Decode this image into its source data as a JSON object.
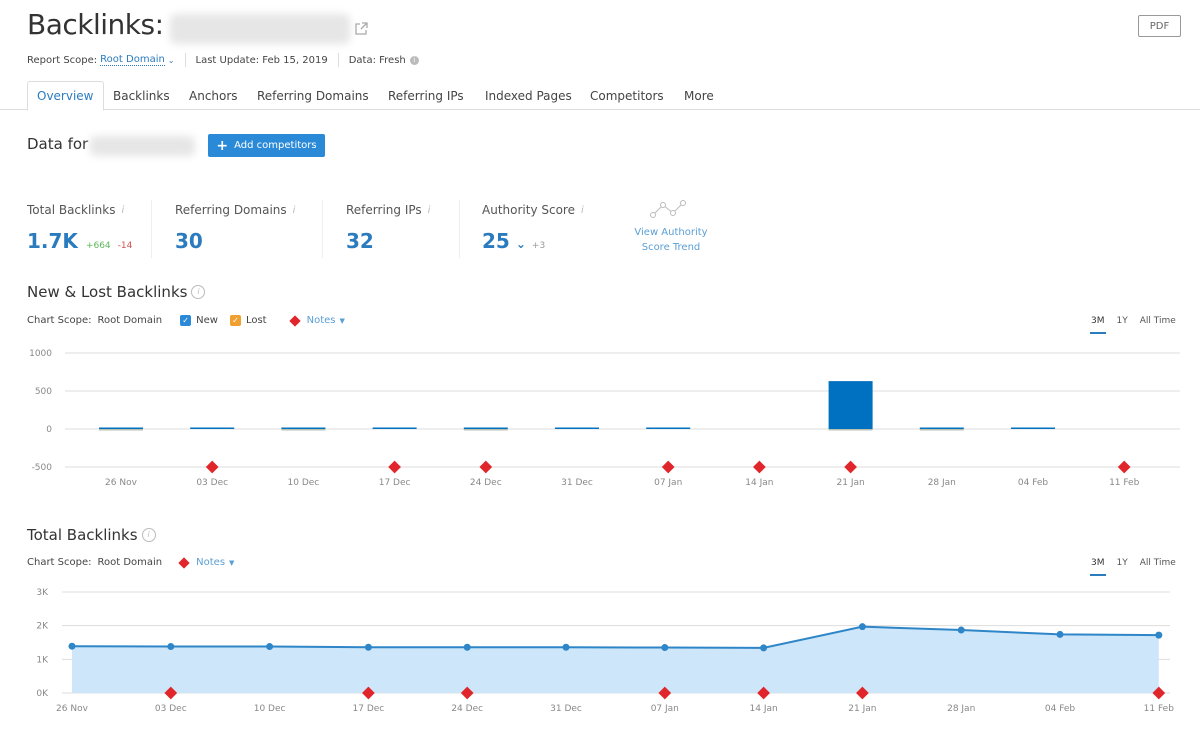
{
  "header": {
    "title": "Backlinks:",
    "pdf_label": "PDF",
    "report_scope_label": "Report Scope:",
    "report_scope_value": "Root Domain",
    "last_update": "Last Update: Feb 15, 2019",
    "data_status": "Data: Fresh"
  },
  "tabs": [
    {
      "label": "Overview",
      "active": true
    },
    {
      "label": "Backlinks"
    },
    {
      "label": "Anchors"
    },
    {
      "label": "Referring Domains"
    },
    {
      "label": "Referring IPs"
    },
    {
      "label": "Indexed Pages"
    },
    {
      "label": "Competitors"
    },
    {
      "label": "More"
    }
  ],
  "data_for": {
    "label": "Data for",
    "add_competitors": "Add competitors"
  },
  "metrics": {
    "total_backlinks": {
      "label": "Total Backlinks",
      "value": "1.7K",
      "new": "+664",
      "lost": "-14"
    },
    "referring_domains": {
      "label": "Referring Domains",
      "value": "30"
    },
    "referring_ips": {
      "label": "Referring IPs",
      "value": "32"
    },
    "authority_score": {
      "label": "Authority Score",
      "value": "25",
      "change": "+3"
    },
    "view_trend_line1": "View Authority",
    "view_trend_line2": "Score Trend"
  },
  "new_lost_section": {
    "title": "New & Lost Backlinks",
    "scope_label": "Chart Scope:",
    "scope_value": "Root Domain",
    "legend_new": "New",
    "legend_lost": "Lost",
    "notes_label": "Notes",
    "ranges": [
      "3M",
      "1Y",
      "All Time"
    ],
    "active_range": "3M"
  },
  "total_section": {
    "title": "Total Backlinks",
    "scope_label": "Chart Scope:",
    "scope_value": "Root Domain",
    "notes_label": "Notes",
    "ranges": [
      "3M",
      "1Y",
      "All Time"
    ],
    "active_range": "3M"
  },
  "colors": {
    "accent": "#2b7bbf",
    "new": "#0070c0",
    "lost": "#f0a030",
    "note": "#e0262b",
    "line": "#2e86c8",
    "area": "#cde6f9"
  },
  "chart_data": [
    {
      "type": "bar",
      "title": "New & Lost Backlinks",
      "categories": [
        "26 Nov",
        "03 Dec",
        "10 Dec",
        "17 Dec",
        "24 Dec",
        "31 Dec",
        "07 Jan",
        "14 Jan",
        "21 Jan",
        "28 Jan",
        "04 Feb",
        "11 Feb"
      ],
      "yticks": [
        "1000",
        "500",
        "0",
        "-500"
      ],
      "ylim": [
        -500,
        1000
      ],
      "series": [
        {
          "name": "New",
          "values": [
            5,
            10,
            5,
            8,
            5,
            8,
            8,
            0,
            630,
            5,
            8,
            0
          ]
        },
        {
          "name": "Lost",
          "values": [
            -8,
            0,
            -8,
            0,
            -8,
            0,
            0,
            0,
            -2,
            -8,
            0,
            0
          ]
        }
      ],
      "notes_at": [
        "03 Dec",
        "17 Dec",
        "24 Dec",
        "07 Jan",
        "14 Jan",
        "21 Jan",
        "11 Feb"
      ],
      "grid": true
    },
    {
      "type": "area",
      "title": "Total Backlinks",
      "x": [
        "26 Nov",
        "03 Dec",
        "10 Dec",
        "17 Dec",
        "24 Dec",
        "31 Dec",
        "07 Jan",
        "14 Jan",
        "21 Jan",
        "28 Jan",
        "04 Feb",
        "11 Feb"
      ],
      "yticks": [
        "3K",
        "2K",
        "1K",
        "0K"
      ],
      "ylim": [
        0,
        3000
      ],
      "series": [
        {
          "name": "Total Backlinks",
          "values": [
            1390,
            1380,
            1380,
            1360,
            1360,
            1360,
            1350,
            1340,
            1970,
            1870,
            1740,
            1720
          ]
        }
      ],
      "notes_at": [
        "03 Dec",
        "17 Dec",
        "24 Dec",
        "07 Jan",
        "14 Jan",
        "21 Jan",
        "11 Feb"
      ],
      "grid": true
    }
  ]
}
